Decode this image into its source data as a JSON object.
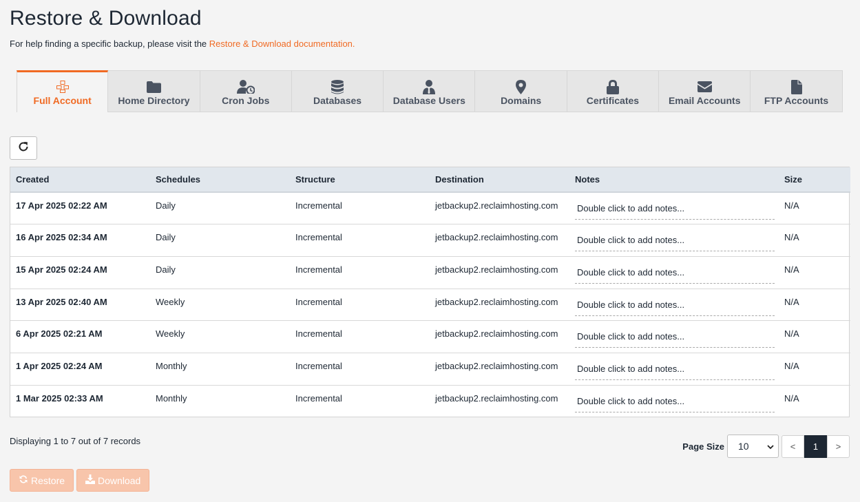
{
  "page": {
    "title": "Restore & Download",
    "help_prefix": "For help finding a specific backup, please visit the ",
    "help_link": "Restore & Download documentation."
  },
  "tabs": [
    {
      "label": "Full Account",
      "icon": "cubes-icon",
      "active": true
    },
    {
      "label": "Home Directory",
      "icon": "folder-icon"
    },
    {
      "label": "Cron Jobs",
      "icon": "user-clock-icon"
    },
    {
      "label": "Databases",
      "icon": "database-icon"
    },
    {
      "label": "Database Users",
      "icon": "user-tie-icon"
    },
    {
      "label": "Domains",
      "icon": "map-marker-icon"
    },
    {
      "label": "Certificates",
      "icon": "lock-icon"
    },
    {
      "label": "Email Accounts",
      "icon": "envelope-icon"
    },
    {
      "label": "FTP Accounts",
      "icon": "file-icon"
    }
  ],
  "table": {
    "headers": {
      "created": "Created",
      "schedules": "Schedules",
      "structure": "Structure",
      "destination": "Destination",
      "notes": "Notes",
      "size": "Size"
    },
    "rows": [
      {
        "created": "17 Apr 2025 02:22 AM",
        "schedules": "Daily",
        "structure": "Incremental",
        "destination": "jetbackup2.reclaimhosting.com",
        "notes": "Double click to add notes...",
        "size": "N/A"
      },
      {
        "created": "16 Apr 2025 02:34 AM",
        "schedules": "Daily",
        "structure": "Incremental",
        "destination": "jetbackup2.reclaimhosting.com",
        "notes": "Double click to add notes...",
        "size": "N/A"
      },
      {
        "created": "15 Apr 2025 02:24 AM",
        "schedules": "Daily",
        "structure": "Incremental",
        "destination": "jetbackup2.reclaimhosting.com",
        "notes": "Double click to add notes...",
        "size": "N/A"
      },
      {
        "created": "13 Apr 2025 02:40 AM",
        "schedules": "Weekly",
        "structure": "Incremental",
        "destination": "jetbackup2.reclaimhosting.com",
        "notes": "Double click to add notes...",
        "size": "N/A"
      },
      {
        "created": "6 Apr 2025 02:21 AM",
        "schedules": "Weekly",
        "structure": "Incremental",
        "destination": "jetbackup2.reclaimhosting.com",
        "notes": "Double click to add notes...",
        "size": "N/A"
      },
      {
        "created": "1 Apr 2025 02:24 AM",
        "schedules": "Monthly",
        "structure": "Incremental",
        "destination": "jetbackup2.reclaimhosting.com",
        "notes": "Double click to add notes...",
        "size": "N/A"
      },
      {
        "created": "1 Mar 2025 02:33 AM",
        "schedules": "Monthly",
        "structure": "Incremental",
        "destination": "jetbackup2.reclaimhosting.com",
        "notes": "Double click to add notes...",
        "size": "N/A"
      }
    ]
  },
  "footer": {
    "records": "Displaying 1 to 7 out of 7 records",
    "page_size_label": "Page Size",
    "page_size_value": "10",
    "prev": "<",
    "current_page": "1",
    "next": ">"
  },
  "actions": {
    "restore": "Restore",
    "download": "Download"
  },
  "colors": {
    "accent": "#f06a23",
    "header_bg": "#e1e7ed",
    "disabled_button": "#f8c5ab"
  }
}
